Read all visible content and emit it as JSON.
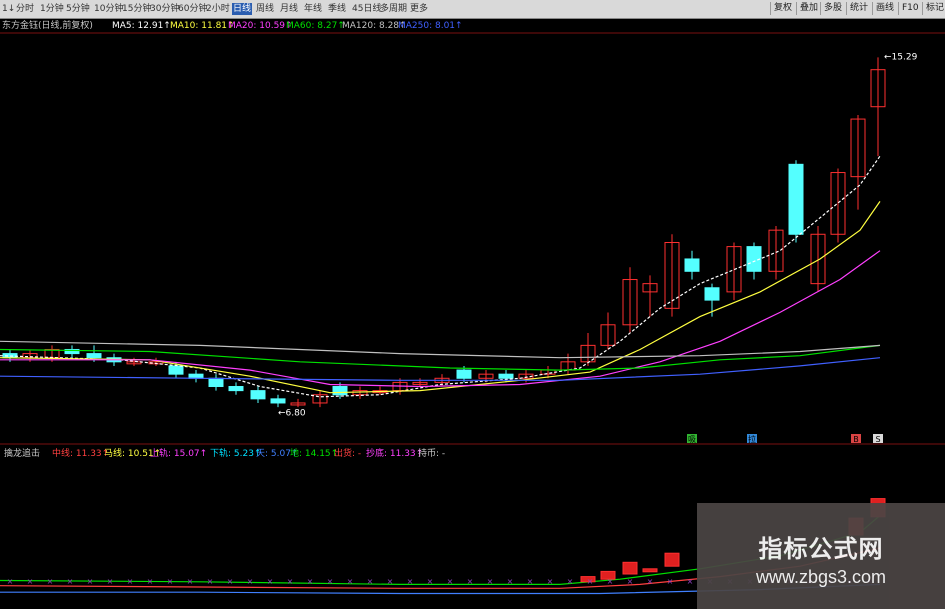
{
  "toolbar": {
    "timeframes": [
      "1↓",
      "分时",
      "1分钟",
      "5分钟",
      "10分钟",
      "15分钟",
      "30分钟",
      "60分钟",
      "2小时",
      "日线",
      "周线",
      "月线",
      "年线",
      "季线",
      "45日线",
      "多周期",
      "更多"
    ],
    "active_timeframe_index": 9,
    "buttons": [
      "复权",
      "叠加",
      "多股",
      "统计",
      "画线",
      "F10",
      "标记"
    ]
  },
  "ma_legend": [
    {
      "label": "东方金钰(日线,前复权)",
      "color": "#c8c8c8"
    },
    {
      "label": "MA5: 12.91↑",
      "color": "#ffffff"
    },
    {
      "label": "MA10: 11.81↑",
      "color": "#ffff40"
    },
    {
      "label": "MA20: 10.59↑",
      "color": "#ff40ff"
    },
    {
      "label": "MA60: 8.27↑",
      "color": "#00e000"
    },
    {
      "label": "MA120: 8.28↑",
      "color": "#c0c0c0"
    },
    {
      "label": "MA250: 8.01↑",
      "color": "#4060ff"
    }
  ],
  "price_labels": {
    "high": "15.29",
    "low": "6.80"
  },
  "signal_marks": [
    {
      "label": "吸",
      "color": "#3ad33a"
    },
    {
      "label": "拉",
      "color": "#3aa0ff"
    },
    {
      "label": "B",
      "color": "#ff5050"
    },
    {
      "label": "S",
      "color": "#ffffff"
    }
  ],
  "indicator_legend": [
    {
      "label": "擒龙追击",
      "color": "#c8c8c8"
    },
    {
      "label": "中线: 11.33↑",
      "color": "#ff4040"
    },
    {
      "label": "马线: 10.51↑",
      "color": "#ffff40"
    },
    {
      "label": "上轨: 15.07↑",
      "color": "#ff40ff"
    },
    {
      "label": "下轨: 5.23↑",
      "color": "#00e0ff"
    },
    {
      "label": "天: 5.07↑",
      "color": "#4080ff"
    },
    {
      "label": "地: 14.15↑",
      "color": "#00e000"
    },
    {
      "label": "出货: -",
      "color": "#ff4040"
    },
    {
      "label": "抄底: 11.33↑",
      "color": "#ff40ff"
    },
    {
      "label": "持币: -",
      "color": "#c8c8c8"
    }
  ],
  "watermark": {
    "title": "指标公式网",
    "url": "www.zbgs3.com"
  },
  "colors": {
    "up": "#ff3030",
    "down": "#54ffff",
    "background": "#000000"
  }
}
